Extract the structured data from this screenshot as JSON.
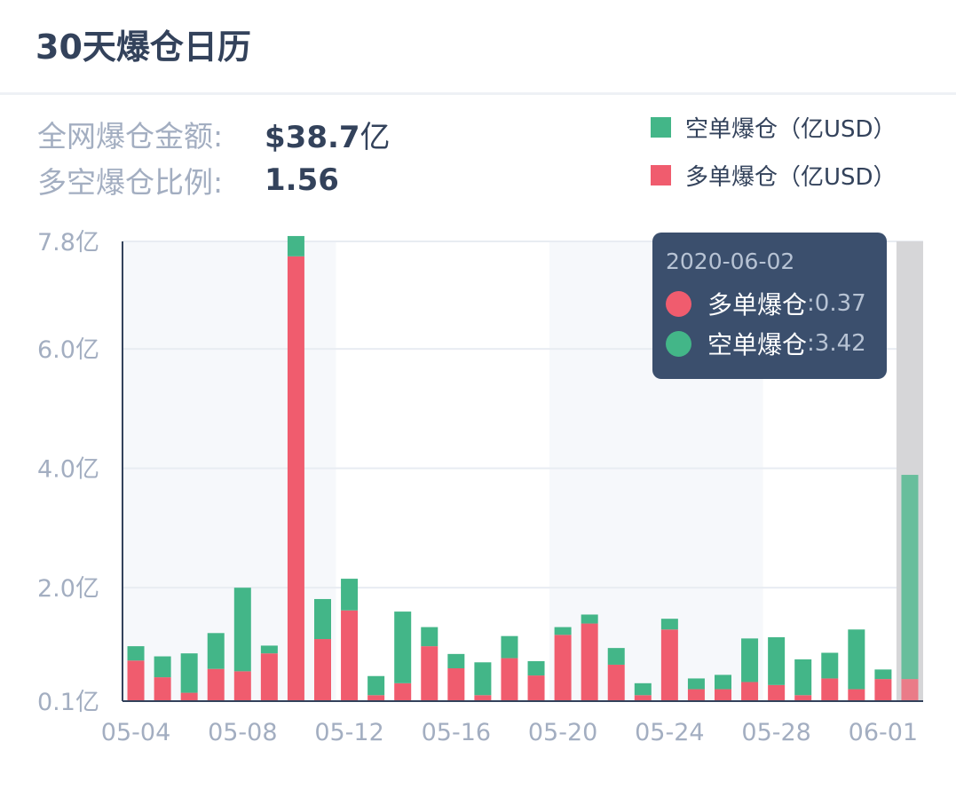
{
  "header": {
    "title": "30天爆仓日历"
  },
  "stats": [
    {
      "label": "全网爆仓金额:",
      "value": "$38.7",
      "unit": "亿"
    },
    {
      "label": "多空爆仓比例:",
      "value": "1.56",
      "unit": ""
    }
  ],
  "legend": [
    {
      "label": "空单爆仓（亿USD）",
      "color": "#43b688"
    },
    {
      "label": "多单爆仓（亿USD）",
      "color": "#f05c6e"
    }
  ],
  "tooltip": {
    "date": "2020-06-02",
    "rows": [
      {
        "name": "多单爆仓",
        "value": "0.37",
        "color": "#f05c6e"
      },
      {
        "name": "空单爆仓",
        "value": "3.42",
        "color": "#43b688"
      }
    ]
  },
  "chart_data": {
    "type": "bar",
    "stacked": true,
    "categories": [
      "05-04",
      "05-05",
      "05-06",
      "05-07",
      "05-08",
      "05-09",
      "05-10",
      "05-11",
      "05-12",
      "05-13",
      "05-14",
      "05-15",
      "05-16",
      "05-17",
      "05-18",
      "05-19",
      "05-20",
      "05-21",
      "05-22",
      "05-23",
      "05-24",
      "05-25",
      "05-26",
      "05-27",
      "05-28",
      "05-29",
      "05-30",
      "05-31",
      "06-01",
      "06-02"
    ],
    "x_tick_labels": [
      "05-04",
      "05-08",
      "05-12",
      "05-16",
      "05-20",
      "05-24",
      "05-28",
      "06-01"
    ],
    "y_tick_labels": [
      "0.1亿",
      "2.0亿",
      "4.0亿",
      "6.0亿",
      "7.8亿"
    ],
    "y_ticks": [
      0.1,
      2.0,
      4.0,
      6.0,
      7.8
    ],
    "ylim": [
      0.1,
      7.8
    ],
    "series": [
      {
        "name": "多单爆仓",
        "color": "#f05c6e",
        "values": [
          0.68,
          0.4,
          0.14,
          0.54,
          0.5,
          0.8,
          7.45,
          1.04,
          1.52,
          0.1,
          0.3,
          0.92,
          0.55,
          0.1,
          0.72,
          0.43,
          1.11,
          1.3,
          0.61,
          0.1,
          1.2,
          0.2,
          0.2,
          0.32,
          0.27,
          0.1,
          0.38,
          0.2,
          0.37,
          0.37
        ]
      },
      {
        "name": "空单爆仓",
        "color": "#43b688",
        "values": [
          0.24,
          0.35,
          0.66,
          0.6,
          1.4,
          0.13,
          0.34,
          0.67,
          0.53,
          0.32,
          1.2,
          0.32,
          0.24,
          0.55,
          0.37,
          0.24,
          0.13,
          0.15,
          0.28,
          0.2,
          0.18,
          0.18,
          0.24,
          0.73,
          0.8,
          0.6,
          0.43,
          1.0,
          0.16,
          3.42
        ]
      }
    ],
    "highlight_category": "06-02",
    "grid": "horizontal",
    "legend_position": "top-right"
  }
}
